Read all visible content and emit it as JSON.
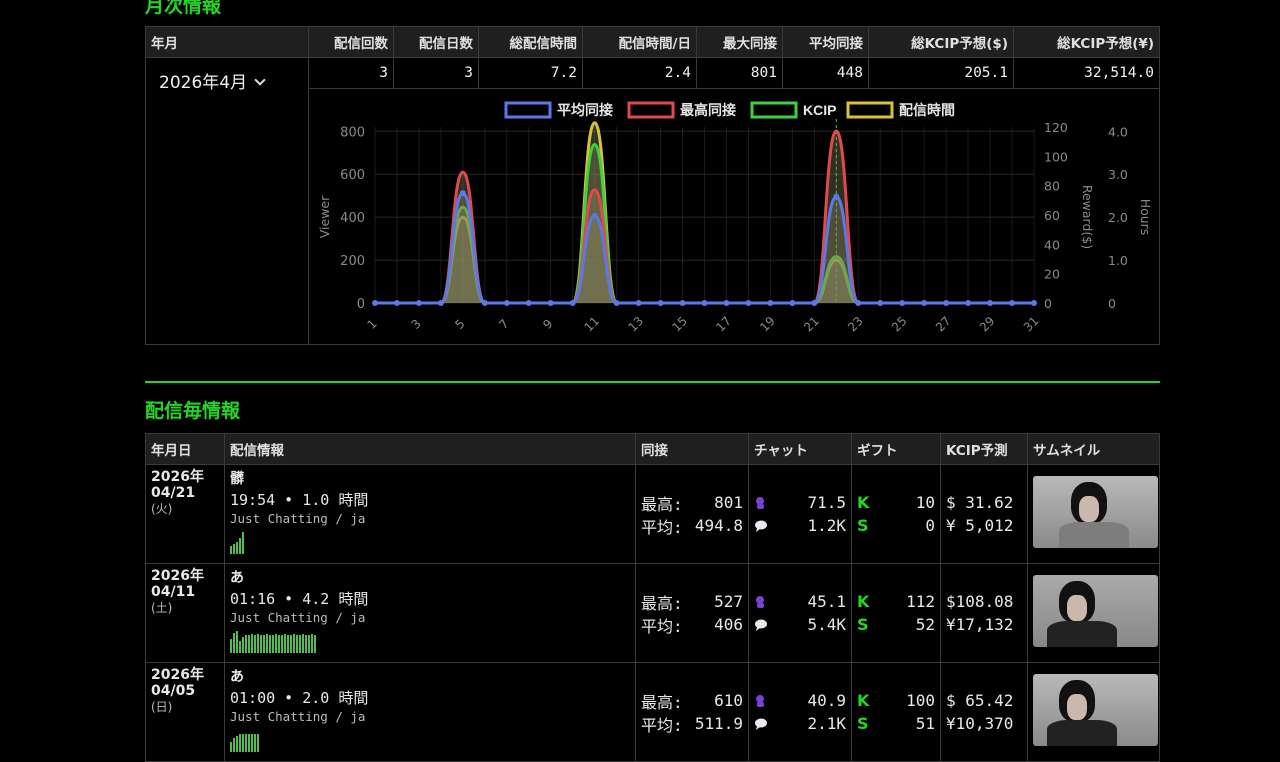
{
  "monthly": {
    "title": "月次情報",
    "headers": [
      "年月",
      "配信回数",
      "配信日数",
      "総配信時間",
      "配信時間/日",
      "最大同接",
      "平均同接",
      "総KCIP予想($)",
      "総KCIP予想(¥)"
    ],
    "month_selected": "2026年4月",
    "values": [
      "3",
      "3",
      "7.2",
      "2.4",
      "801",
      "448",
      "205.1",
      "32,514.0"
    ]
  },
  "chart_data": {
    "type": "line",
    "legend": [
      "平均同接",
      "最高同接",
      "KCIP",
      "配信時間"
    ],
    "colors": {
      "avg": "#5b78e6",
      "max": "#e04a4a",
      "kcip": "#3fcf3f",
      "time": "#d9c23a"
    },
    "x": [
      1,
      2,
      3,
      4,
      5,
      6,
      7,
      8,
      9,
      10,
      11,
      12,
      13,
      14,
      15,
      16,
      17,
      18,
      19,
      20,
      21,
      22,
      23,
      24,
      25,
      26,
      27,
      28,
      29,
      30,
      31
    ],
    "xtick_labels": [
      "1",
      "3",
      "5",
      "7",
      "9",
      "11",
      "13",
      "15",
      "17",
      "19",
      "21",
      "23",
      "25",
      "27",
      "29",
      "31"
    ],
    "y_left_label": "Viewer",
    "y_left_ticks": [
      "0",
      "200",
      "400",
      "600",
      "800"
    ],
    "y_reward_label": "Reward($)",
    "y_reward_ticks": [
      "0",
      "20",
      "40",
      "60",
      "80",
      "100",
      "120"
    ],
    "y_hours_label": "Hours",
    "y_hours_ticks": [
      "0",
      "1.0",
      "2.0",
      "3.0",
      "4.0"
    ],
    "series": [
      {
        "name": "平均同接",
        "axis": "viewer",
        "points": {
          "5": 512,
          "11": 406,
          "22": 495
        }
      },
      {
        "name": "最高同接",
        "axis": "viewer",
        "points": {
          "5": 610,
          "11": 527,
          "22": 801
        }
      },
      {
        "name": "KCIP",
        "axis": "reward",
        "points": {
          "5": 65.4,
          "11": 108.1,
          "22": 31.6
        }
      },
      {
        "name": "配信時間",
        "axis": "hours",
        "points": {
          "5": 2.0,
          "11": 4.2,
          "22": 1.0
        }
      }
    ],
    "ylim_viewer": [
      0,
      820
    ],
    "ylim_reward": [
      0,
      120
    ],
    "ylim_hours": [
      0,
      4.1
    ]
  },
  "streams": {
    "title": "配信毎情報",
    "headers": [
      "年月日",
      "配信情報",
      "同接",
      "チャット",
      "ギフト",
      "KCIP予測",
      "サムネイル"
    ],
    "max_label": "最高:",
    "avg_label": "平均:",
    "rows": [
      {
        "year": "2026年",
        "md": "04/21",
        "wd": "(火)",
        "title": "髒",
        "time": "19:54 • 1.0 時間",
        "cat": "Just Chatting / ja",
        "max": "801",
        "avg": "494.8",
        "chat1": "71.5",
        "chat2": "1.2K",
        "gift1": "10",
        "gift2": "0",
        "usd": "$ 31.62",
        "jpy": "¥ 5,012",
        "spark": [
          8,
          10,
          12,
          16,
          22
        ]
      },
      {
        "year": "2026年",
        "md": "04/11",
        "wd": "(土)",
        "title": "あ",
        "time": "01:16 • 4.2 時間",
        "cat": "Just Chatting / ja",
        "max": "527",
        "avg": "406",
        "chat1": "45.1",
        "chat2": "5.4K",
        "gift1": "112",
        "gift2": "52",
        "usd": "$108.08",
        "jpy": "¥17,132",
        "spark": [
          14,
          20,
          22,
          12,
          16,
          18,
          18,
          19,
          18,
          19,
          18,
          18,
          19,
          18,
          18,
          19,
          18,
          18,
          19,
          18,
          18,
          19,
          18,
          18,
          19,
          18,
          18,
          19,
          18
        ]
      },
      {
        "year": "2026年",
        "md": "04/05",
        "wd": "(日)",
        "title": "あ",
        "time": "01:00 • 2.0 時間",
        "cat": "Just Chatting / ja",
        "max": "610",
        "avg": "511.9",
        "chat1": "40.9",
        "chat2": "2.1K",
        "gift1": "100",
        "gift2": "51",
        "usd": "$ 65.42",
        "jpy": "¥10,370",
        "spark": [
          10,
          14,
          16,
          18,
          18,
          18,
          18,
          18,
          18,
          18
        ]
      }
    ]
  }
}
